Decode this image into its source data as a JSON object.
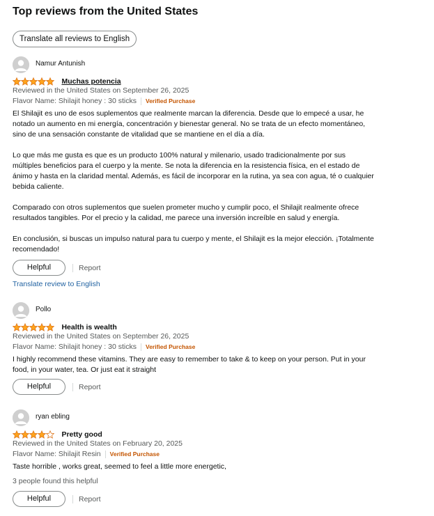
{
  "page": {
    "title": "Top reviews from the United States",
    "translate_all_label": "Translate all reviews to English"
  },
  "colors": {
    "star": "#ffa41c",
    "star_outline": "#de7921",
    "verified": "#c45500",
    "link": "#2162a1",
    "muted": "#565959"
  },
  "reviews": [
    {
      "author": "Namur Antunish",
      "rating": 5,
      "rating_max": 5,
      "title": "Muchas potencia",
      "meta": "Reviewed in the United States on September 26, 2025",
      "flavor": "Flavor Name: Shilajit honey : 30 sticks",
      "verified": "Verified Purchase",
      "body": [
        "El Shilajit es uno de esos suplementos que realmente marcan la diferencia. Desde que lo empecé a usar, he notado un aumento en mi energía, concentración y bienestar general. No se trata de un efecto momentáneo, sino de una sensación constante de vitalidad que se mantiene en el día a día.",
        "Lo que más me gusta es que es un producto 100% natural y milenario, usado tradicionalmente por sus múltiples beneficios para el cuerpo y la mente. Se nota la diferencia en la resistencia física, en el estado de ánimo y hasta en la claridad mental. Además, es fácil de incorporar en la rutina, ya sea con agua, té o cualquier bebida caliente.",
        "Comparado con otros suplementos que suelen prometer mucho y cumplir poco, el Shilajit realmente ofrece resultados tangibles. Por el precio y la calidad, me parece una inversión increíble en salud y energía.",
        "En conclusión, si buscas un impulso natural para tu cuerpo y mente, el Shilajit es la mejor elección. ¡Totalmente recomendado!"
      ],
      "helpful_label": "Helpful",
      "report_label": "Report",
      "translate_label": "Translate review to English"
    },
    {
      "author": "Pollo",
      "rating": 5,
      "rating_max": 5,
      "title": "Health is wealth",
      "meta": "Reviewed in the United States on September 26, 2025",
      "flavor": "Flavor Name: Shilajit honey : 30 sticks",
      "verified": "Verified Purchase",
      "body": [
        "I highly recommend these vitamins. They are easy to remember to take & to keep on your person. Put in your food, in your water, tea. Or just eat it straight"
      ],
      "helpful_label": "Helpful",
      "report_label": "Report"
    },
    {
      "author": "ryan ebling",
      "rating": 4,
      "rating_max": 5,
      "title": "Pretty good",
      "meta": "Reviewed in the United States on February 20, 2025",
      "flavor": "Flavor Name: Shilajit Resin",
      "verified": "Verified Purchase",
      "body": [
        "Taste horrible , works great, seemed to feel a little more energetic,"
      ],
      "helpful_count": "3 people found this helpful",
      "helpful_label": "Helpful",
      "report_label": "Report"
    }
  ]
}
